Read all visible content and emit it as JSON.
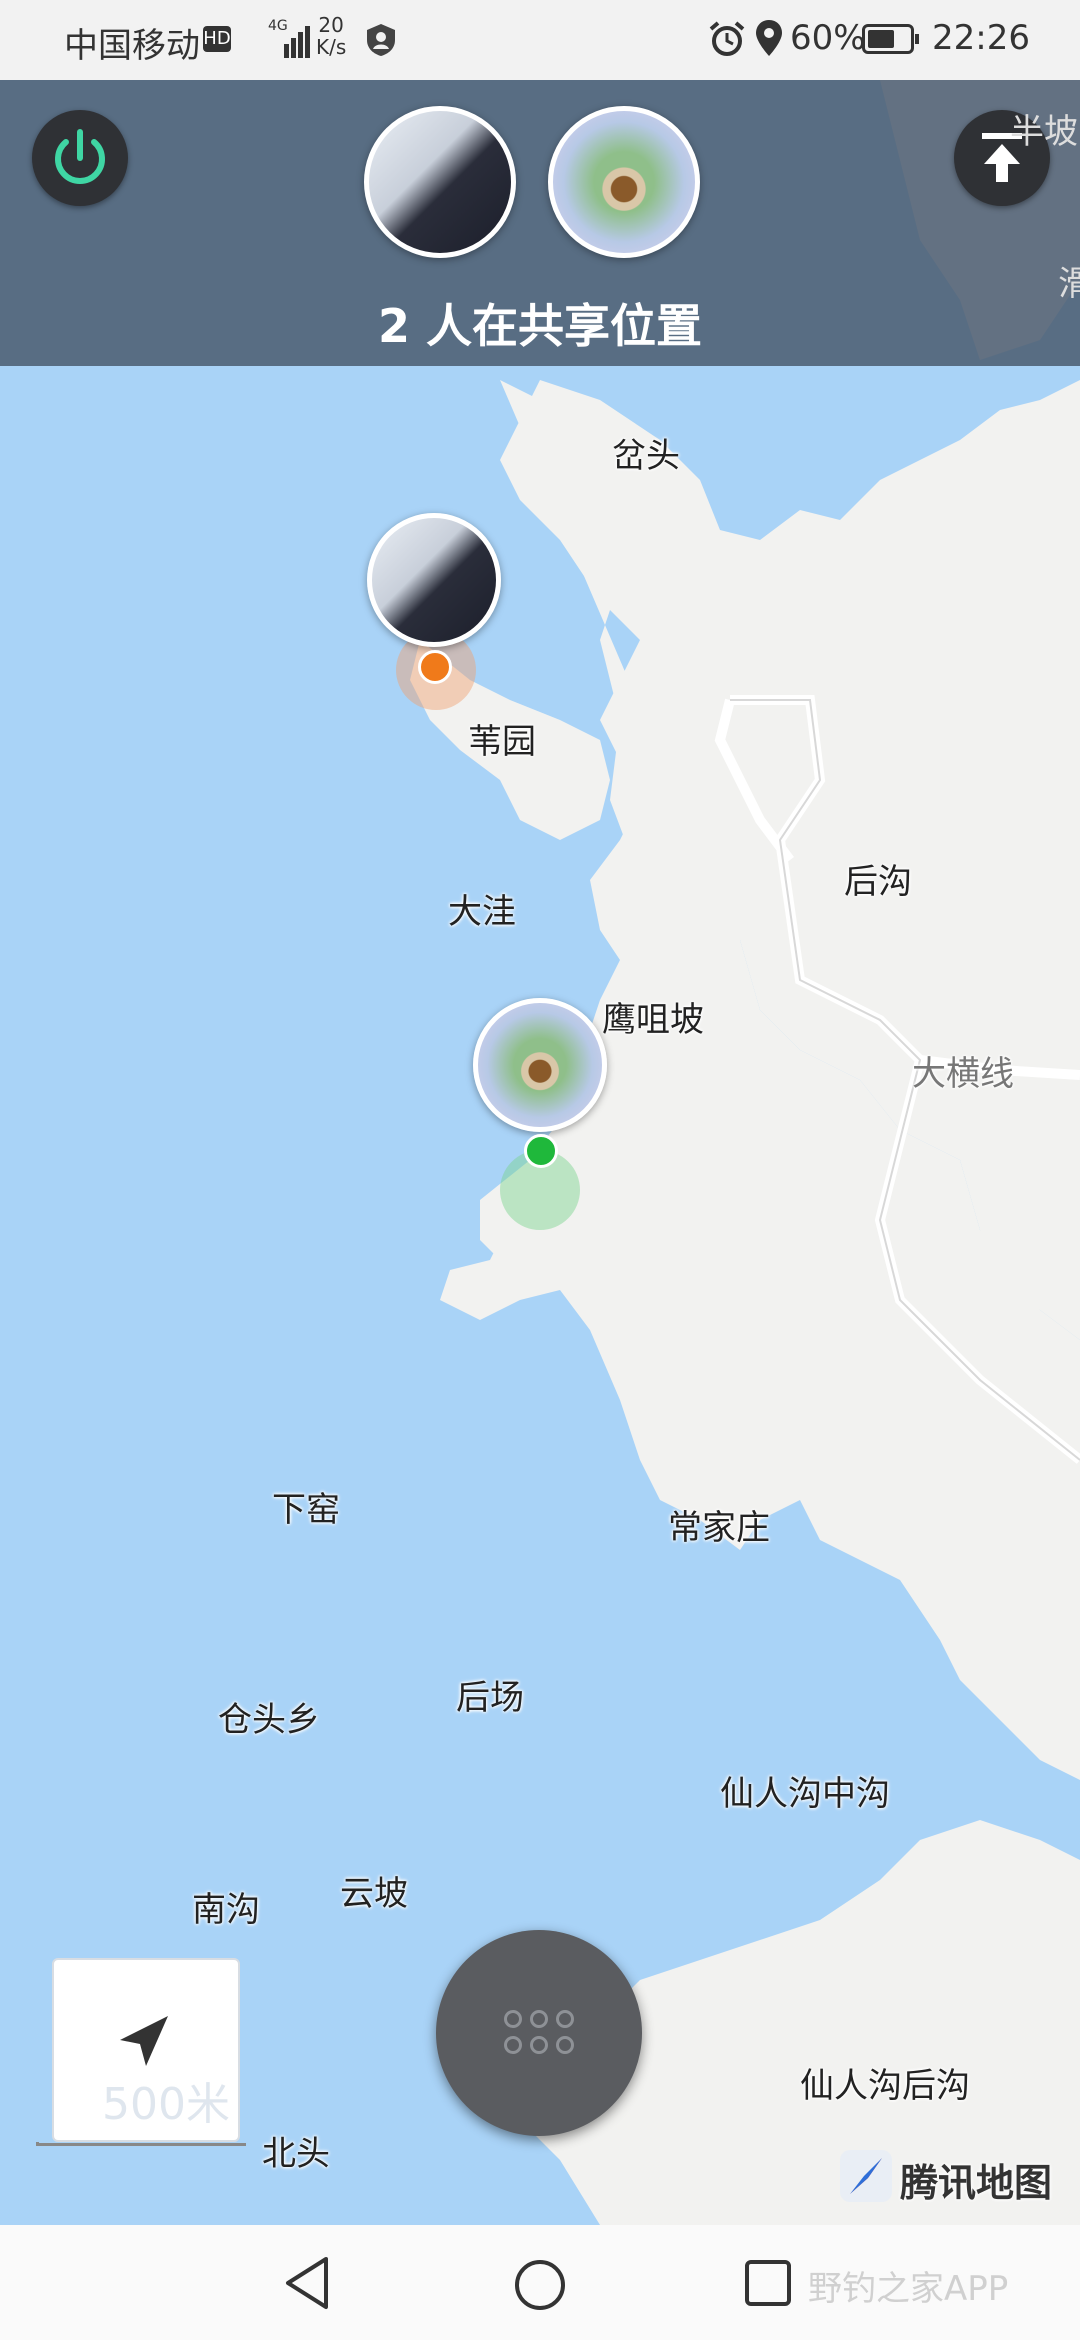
{
  "status_bar": {
    "carrier": "中国移动",
    "hd": "HD",
    "network": "4G",
    "speed_value": "20",
    "speed_unit": "K/s",
    "battery": "60%",
    "time": "22:26"
  },
  "share_panel": {
    "title": "2 人在共享位置",
    "participants": [
      "avatar-1",
      "avatar-2"
    ]
  },
  "map": {
    "labels": {
      "fentou": "岔头",
      "weiyuan": "苇园",
      "houguo": "后沟",
      "dawa": "大洼",
      "yingzuipo": "鹰咀坡",
      "dahengxian": "大横线",
      "xiayao": "下窑",
      "changjiazhuang": "常家庄",
      "houchang": "后场",
      "cangtouxiang": "仓头乡",
      "xianrengou_zhonggou": "仙人沟中沟",
      "nangou": "南沟",
      "yunpo": "云坡",
      "xianrengou_hougou": "仙人沟后沟",
      "beitou": "北头",
      "banpo": "半坡",
      "hua": "滑"
    },
    "scale": "500米",
    "attribution": "腾讯地图",
    "pin_colors": {
      "user1": "#f07a1a",
      "user2": "#1fb83b"
    }
  },
  "nav_bar": {
    "watermark": "野钓之家APP"
  },
  "colors": {
    "water": "#a9d3f7",
    "land": "#f2f2f0",
    "accent_power": "#3fd6a4"
  }
}
